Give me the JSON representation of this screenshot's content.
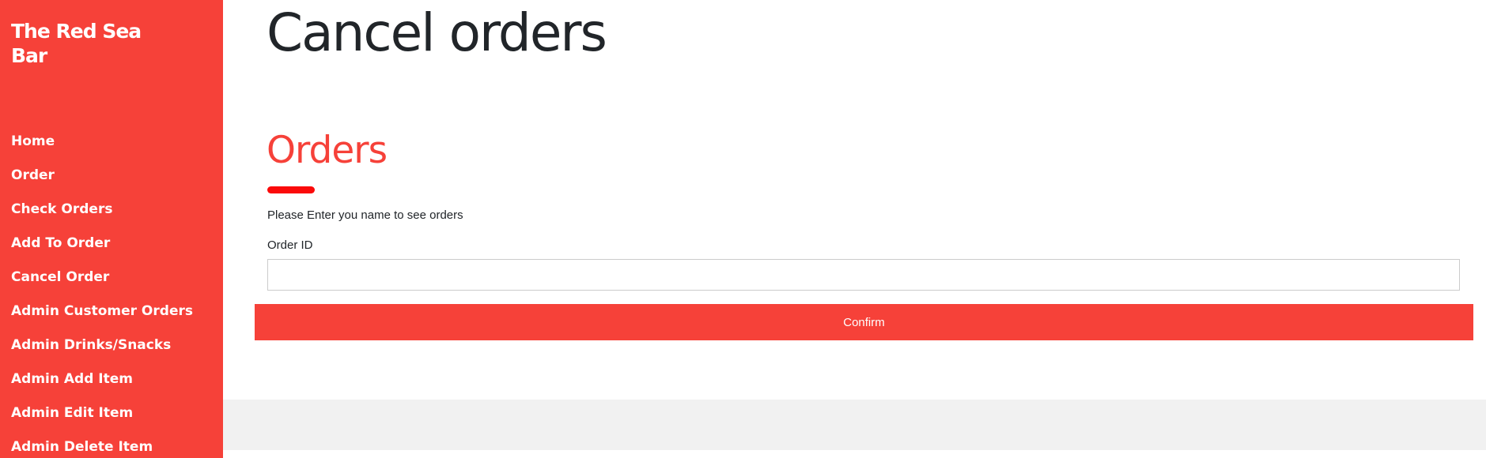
{
  "colors": {
    "accent": "#f64139",
    "underline": "#fb0a0a",
    "text": "#212529",
    "footer_band": "#f1f1f1"
  },
  "sidebar": {
    "brand": "The Red Sea Bar",
    "items": [
      {
        "label": "Home"
      },
      {
        "label": "Order"
      },
      {
        "label": "Check Orders"
      },
      {
        "label": "Add To Order"
      },
      {
        "label": "Cancel Order"
      },
      {
        "label": "Admin Customer Orders"
      },
      {
        "label": "Admin Drinks/Snacks"
      },
      {
        "label": "Admin Add Item"
      },
      {
        "label": "Admin Edit Item"
      },
      {
        "label": "Admin Delete Item"
      }
    ]
  },
  "main": {
    "page_title": "Cancel orders",
    "section_title": "Orders",
    "instruction": "Please Enter you name to see orders",
    "form": {
      "order_id_label": "Order ID",
      "order_id_value": "",
      "order_id_placeholder": "",
      "confirm_label": "Confirm"
    }
  }
}
